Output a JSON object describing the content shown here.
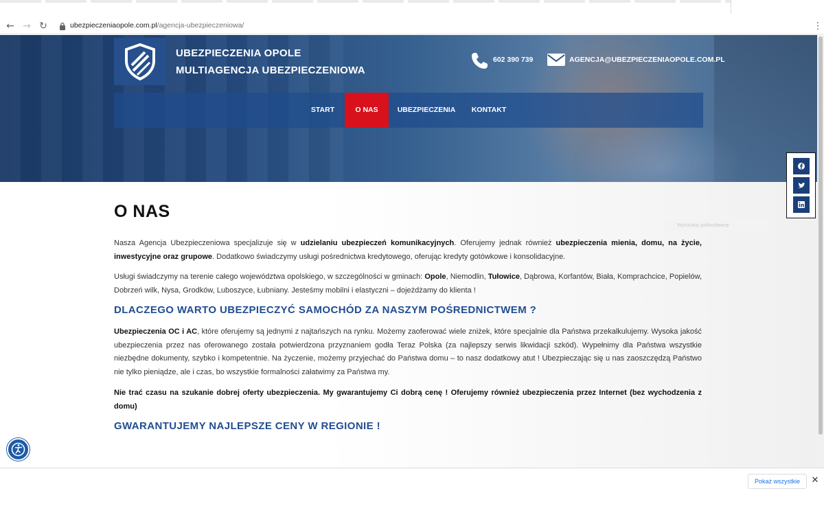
{
  "browser": {
    "url_host": "ubezpieczeniaopole.com.pl",
    "url_path": "/agencja-ubezpieczeniowa/",
    "icons": [
      "back-arrow-icon",
      "forward-arrow-icon",
      "reload-icon",
      "lock-icon",
      "menu-kebab-icon"
    ]
  },
  "header": {
    "brand_line1": "UBEZPIECZENIA OPOLE",
    "brand_line2": "MULTIAGENCJA UBEZPIECZENIOWA",
    "phone": "602 390 739",
    "email": "AGENCJA@UBEZPIECZENIAOPOLE.COM.PL",
    "nav": [
      {
        "label": "START"
      },
      {
        "label": "O NAS"
      },
      {
        "label": "UBEZPIECZENIA"
      },
      {
        "label": "KONTAKT"
      }
    ],
    "active_nav": "O NAS"
  },
  "social": [
    "facebook-icon",
    "twitter-icon",
    "linkedin-icon"
  ],
  "content": {
    "title": "O NAS",
    "search_placeholder": "Wyszukaj polisodawcę",
    "p1_a": "Nasza Agencja Ubezpieczeniowa specjalizuje się w ",
    "p1_b": "udzielaniu ubezpieczeń komunikacyjnych",
    "p1_c": ". Oferujemy jednak również ",
    "p1_d": "ubezpieczenia mienia, domu, na życie, inwestycyjne oraz grupowe",
    "p1_e": ". Dodatkowo świadczymy usługi pośrednictwa kredytowego, oferując kredyty gotówkowe i konsolidacyjne.",
    "p2_a": "Usługi świadczymy na terenie całego województwa opolskiego, w szczególności w gminach: ",
    "p2_b": "Opole",
    "p2_c": ", Niemodlin, ",
    "p2_d": "Tułowice",
    "p2_e": ", Dąbrowa, Korfantów, Biała, Komprachcice, Popielów, Dobrzeń wilk, Nysa, Grodków, Luboszyce, Łubniany. Jesteśmy mobilni i elastyczni – dojeżdżamy do klienta !",
    "h2_1": "DLACZEGO WARTO UBEZPIECZYĆ SAMOCHÓD ZA NASZYM POŚREDNICTWEM ?",
    "p3_a": "Ubezpieczenia OC i AC",
    "p3_b": ", które oferujemy są jednymi z najtańszych na rynku. Możemy  zaoferować wiele zniżek, które specjalnie dla Państwa przekalkulujemy. Wysoka jakość ubezpieczenia przez nas oferowanego została potwierdzona przyznaniem godła Teraz Polska (za najlepszy serwis likwidacji szkód). Wypełnimy dla Państwa wszystkie niezbędne dokumenty, szybko i kompetentnie. Na życzenie, możemy przyjechać do Państwa domu – to nasz dodatkowy atut ! Ubezpieczając się u nas zaoszczędzą Państwo nie tylko pieniądze, ale i czas, bo wszystkie formalności załatwimy za Państwa my.",
    "p4": "Nie trać czasu na szukanie dobrej oferty ubezpieczenia. My gwarantujemy Ci dobrą cenę ! Oferujemy również ubezpieczenia przez Internet (bez wychodzenia z domu)",
    "h2_2": "GWARANTUJEMY NAJLEPSZE CENY W REGIONIE !"
  },
  "downloads": {
    "show_all": "Pokaż wszystkie"
  },
  "colors": {
    "brand_blue": "#214d91",
    "nav_active": "#d8111c",
    "logo_bg": "#264f8c"
  }
}
